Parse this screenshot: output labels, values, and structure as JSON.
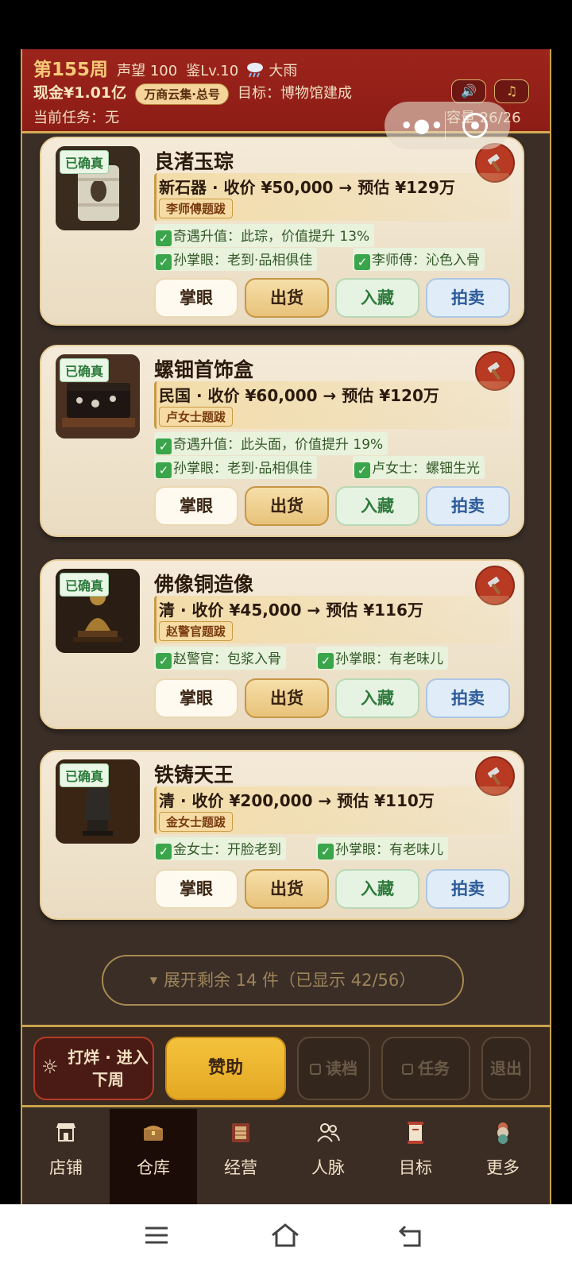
{
  "header": {
    "week": "第155周",
    "reputation": "声望 100",
    "appraisal_level": "鉴Lv.10",
    "weather_icon": "rain-cloud-icon",
    "weather": "大雨",
    "cash": "现金¥1.01亿",
    "merchant_badge": "万商云集·总号",
    "goal": "目标：博物馆建成",
    "current_task": "当前任务：无",
    "capacity": "容量 26/26",
    "sound_icon": "speaker-icon",
    "music_icon": "music-note-icon"
  },
  "items": [
    {
      "name": "良渚玉琮",
      "badge": "已确真",
      "price_line": "新石器 · 收价 ¥50,000 → 预估 ¥129万",
      "inscription": "李师傅题跋",
      "tags": [
        "奇遇升值：此琮，价值提升 13%",
        "孙掌眼：老到·品相俱佳",
        "李师傅：沁色入骨"
      ]
    },
    {
      "name": "螺钿首饰盒",
      "badge": "已确真",
      "price_line": "民国 · 收价 ¥60,000 → 预估 ¥120万",
      "inscription": "卢女士题跋",
      "tags": [
        "奇遇升值：此头面，价值提升 19%",
        "孙掌眼：老到·品相俱佳",
        "卢女士：螺钿生光"
      ]
    },
    {
      "name": "佛像铜造像",
      "badge": "已确真",
      "price_line": "清 · 收价 ¥45,000 → 预估 ¥116万",
      "inscription": "赵警官题跋",
      "tags": [
        "赵警官：包浆入骨",
        "孙掌眼：有老味儿"
      ]
    },
    {
      "name": "铁铸天王",
      "badge": "已确真",
      "price_line": "清 · 收价 ¥200,000 → 预估 ¥110万",
      "inscription": "金女士题跋",
      "tags": [
        "金女士：开脸老到",
        "孙掌眼：有老味儿"
      ]
    }
  ],
  "item_actions": {
    "appraise": "掌眼",
    "sell": "出货",
    "collect": "入藏",
    "auction": "拍卖"
  },
  "expand": "展开剩余 14 件（已显示 42/56）",
  "actions": {
    "next_week": "打烊 · 进入下周",
    "sponsor": "赞助",
    "load": "读档",
    "task": "任务",
    "exit": "退出"
  },
  "tabs": [
    {
      "label": "店铺",
      "icon": "shop-icon"
    },
    {
      "label": "仓库",
      "icon": "warehouse-chest-icon",
      "active": true
    },
    {
      "label": "经营",
      "icon": "ledger-icon"
    },
    {
      "label": "人脉",
      "icon": "people-icon"
    },
    {
      "label": "目标",
      "icon": "scroll-target-icon"
    },
    {
      "label": "更多",
      "icon": "more-icon"
    }
  ],
  "colors": {
    "header_red": "#9c241c",
    "gold": "#c9a24a",
    "card_bg": "#f4ead8",
    "sponsor_gold": "#f4c23c"
  }
}
